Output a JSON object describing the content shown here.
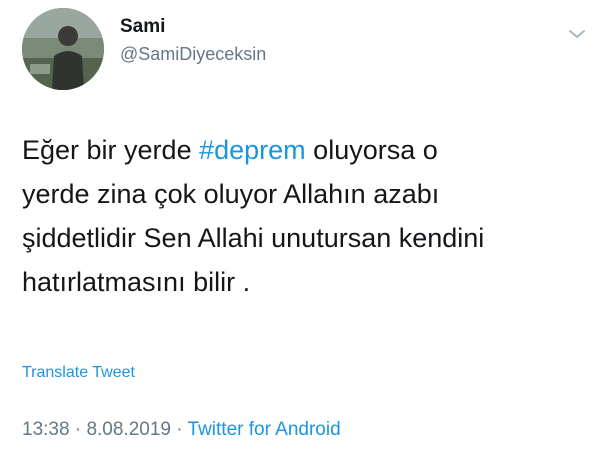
{
  "author": {
    "display_name": "Sami",
    "handle": "@SamiDiyeceksin",
    "avatar_icon": "profile-photo"
  },
  "tweet": {
    "lines": [
      {
        "before": "Eğer bir yerde ",
        "hashtag": "#deprem",
        "after": " oluyorsa o"
      },
      {
        "text": "yerde zina çok oluyor Allahın azabı"
      },
      {
        "text": "şiddetlidir Sen Allahi unutursan kendini"
      },
      {
        "text": "hatırlatmasını bilir ."
      }
    ]
  },
  "actions": {
    "translate_label": "Translate Tweet",
    "menu_icon": "chevron-down-icon"
  },
  "meta": {
    "time": "13:38",
    "separator": " · ",
    "date": "8.08.2019",
    "source": "Twitter for Android"
  },
  "colors": {
    "link": "#1b95e0",
    "secondary_text": "#657786",
    "primary_text": "#14171a"
  }
}
